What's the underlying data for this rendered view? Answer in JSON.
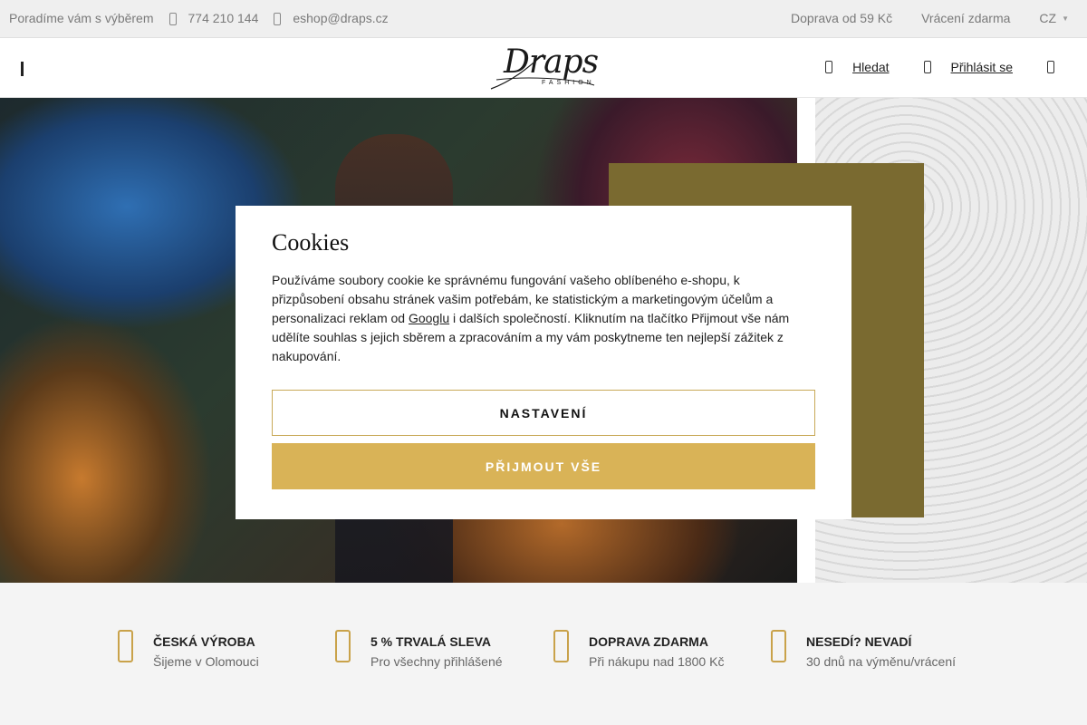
{
  "topbar": {
    "advice": "Poradíme vám s výběrem",
    "phone": "774 210 144",
    "email": "eshop@draps.cz",
    "shipping": "Doprava od 59 Kč",
    "returns": "Vrácení zdarma",
    "language": "CZ"
  },
  "header": {
    "logo_text": "Draps",
    "logo_sub": "FASHION",
    "search_label": "Hledat",
    "login_label": "Přihlásit se"
  },
  "cookie": {
    "title": "Cookies",
    "text_before_link": "Používáme soubory cookie ke správnému fungování vašeho oblíbeného e-shopu, k přizpůsobení obsahu stránek vašim potřebám, ke statistickým a marketingovým účelům a personalizaci reklam od ",
    "link_text": "Googlu",
    "text_after_link": " i dalších společností. Kliknutím na tlačítko Přijmout vše nám udělíte souhlas s jejich sběrem a zpracováním a my vám poskytneme ten nejlepší zážitek z nakupování.",
    "settings_label": "NASTAVENÍ",
    "accept_label": "PŘIJMOUT VŠE"
  },
  "usp": [
    {
      "title": "ČESKÁ VÝROBA",
      "subtitle": "Šijeme v Olomouci"
    },
    {
      "title": "5 % TRVALÁ SLEVA",
      "subtitle": "Pro všechny přihlášené"
    },
    {
      "title": "DOPRAVA ZDARMA",
      "subtitle": "Při nákupu nad 1800 Kč"
    },
    {
      "title": "NESEDÍ? NEVADÍ",
      "subtitle": "30 dnů na výměnu/vrácení"
    }
  ],
  "colors": {
    "accent_gold": "#d9b357",
    "gold_border": "#c8a957",
    "usp_icon": "#c9a24a",
    "hero_panel": "#7a6a30"
  }
}
